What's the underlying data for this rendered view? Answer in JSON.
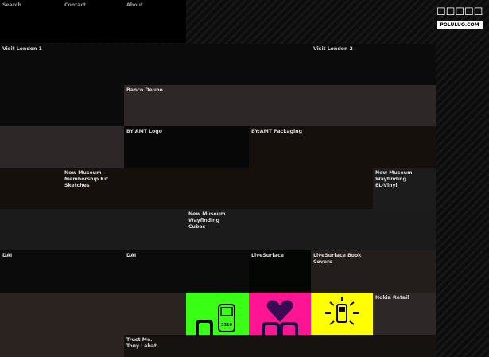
{
  "nav": {
    "search": "Search",
    "contact": "Contact",
    "about": "About"
  },
  "watermark": {
    "glyphs": "☐☐☐☐☐",
    "url": "POLULUO.COM"
  },
  "projects": {
    "visit_london_1": "Visit London 1",
    "visit_london_2": "Visit London 2",
    "banco_deuno": "Banco Deuno",
    "byamt_logo": "BY:AMT Logo",
    "byamt_packaging": "BY:AMT Packaging",
    "new_museum_membership": "New Museum\nMembership Kit\nSketches",
    "new_museum_wayfinding_vinyl": "New Museum\nWayfinding\nEL-Vinyl",
    "new_museum_wayfinding_cubes": "New Museum\nWayfinding\nCubes",
    "dai_1": "DAI",
    "dai_2": "DAI",
    "livesurface": "LiveSurface",
    "livesurface_book": "LiveSurface Book\nCovers",
    "nokia_retail": "Nokia Retail",
    "trust_me": "Trust Me.\nTony Labat"
  },
  "thumbnails": [
    {
      "name": "nokia-phone-green",
      "color": "#39ff14"
    },
    {
      "name": "nokia-heart-magenta",
      "color": "#ff1493"
    },
    {
      "name": "nokia-phone-yellow",
      "color": "#ffff00"
    }
  ],
  "colors": {
    "background": "#000000",
    "tile_dark": "#0b0b0b",
    "tile_brown": "#2e2727",
    "tile_gray": "#1b1b1b",
    "label": "#d8d8d8"
  }
}
